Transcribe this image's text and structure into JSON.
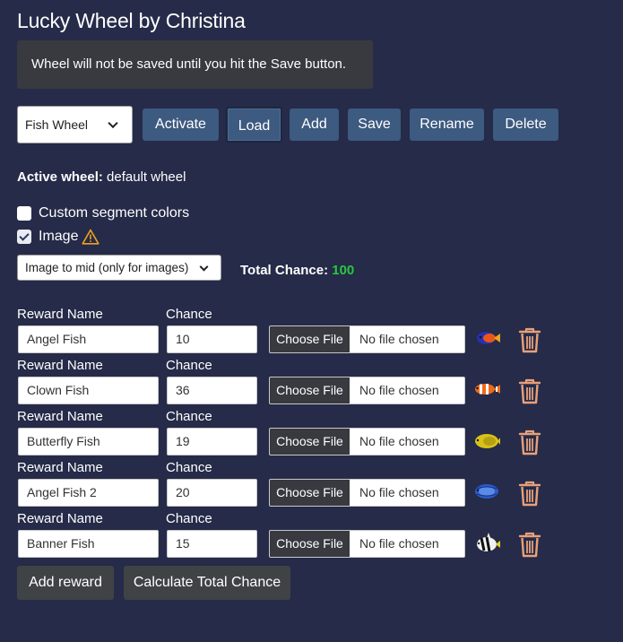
{
  "title": "Lucky Wheel by Christina",
  "notice": "Wheel will not be saved until you hit the Save button.",
  "wheel_select": {
    "value": "Fish Wheel"
  },
  "toolbar": {
    "activate": "Activate",
    "load": "Load",
    "add": "Add",
    "save": "Save",
    "rename": "Rename",
    "delete": "Delete"
  },
  "active_wheel": {
    "label": "Active wheel:",
    "value": "default wheel"
  },
  "options": {
    "custom_colors": {
      "label": "Custom segment colors",
      "checked": false
    },
    "image": {
      "label": "Image",
      "checked": true,
      "icon": "warning-icon"
    }
  },
  "image_mode": {
    "value": "Image to mid (only for images)"
  },
  "total_chance": {
    "label": "Total Chance:",
    "value": "100"
  },
  "reward_labels": {
    "name": "Reward Name",
    "chance": "Chance"
  },
  "file_input": {
    "button": "Choose File",
    "status": "No file chosen"
  },
  "rewards": [
    {
      "name": "Angel Fish",
      "chance": "10",
      "fish_icon": "angelfish-icon"
    },
    {
      "name": "Clown Fish",
      "chance": "36",
      "fish_icon": "clownfish-icon"
    },
    {
      "name": "Butterfly Fish",
      "chance": "19",
      "fish_icon": "butterflyfish-icon"
    },
    {
      "name": "Angel Fish 2",
      "chance": "20",
      "fish_icon": "blue-angelfish-icon"
    },
    {
      "name": "Banner Fish",
      "chance": "15",
      "fish_icon": "bannerfish-icon"
    }
  ],
  "actions": {
    "add_reward": "Add reward",
    "calculate": "Calculate Total Chance"
  },
  "colors": {
    "background": "#252b48",
    "button_blue": "#3d5a80",
    "button_dark": "#404346",
    "total_green": "#28c840",
    "trash_orange": "#e8a07a"
  }
}
